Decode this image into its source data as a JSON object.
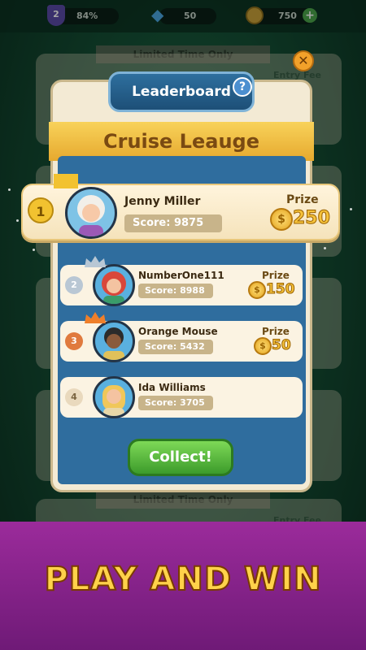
{
  "topbar": {
    "level": "2",
    "level_percent": "84%",
    "gems": "50",
    "coins": "750",
    "plus": "+"
  },
  "background": {
    "banner_1": "Limited Time Only",
    "banner_2": "Limited Time Only",
    "entry_fee_1": "Entry Fee",
    "entry_fee_2": "Entry Fee"
  },
  "dialog": {
    "title": "Leaderboard",
    "help": "?",
    "close": "✕",
    "league": "Cruise Leauge",
    "collect": "Collect!"
  },
  "leaderboard": [
    {
      "rank": "1",
      "name": "Jenny Miller",
      "score": "Score: 9875",
      "prize_label": "Prize",
      "prize": "250"
    },
    {
      "rank": "2",
      "name": "NumberOne111",
      "score": "Score: 8988",
      "prize_label": "Prize",
      "prize": "150"
    },
    {
      "rank": "3",
      "name": "Orange Mouse",
      "score": "Score: 5432",
      "prize_label": "Prize",
      "prize": "50"
    },
    {
      "rank": "4",
      "name": "Ida Williams",
      "score": "Score: 3705"
    }
  ],
  "footer": {
    "text": "PLAY AND WIN"
  },
  "colors": {
    "felt": "#1d6b47",
    "gold": "#f6c23a",
    "panel": "#2f6d9e",
    "collect_green": "#3c9b2b",
    "footer_purple": "#8b2489"
  }
}
